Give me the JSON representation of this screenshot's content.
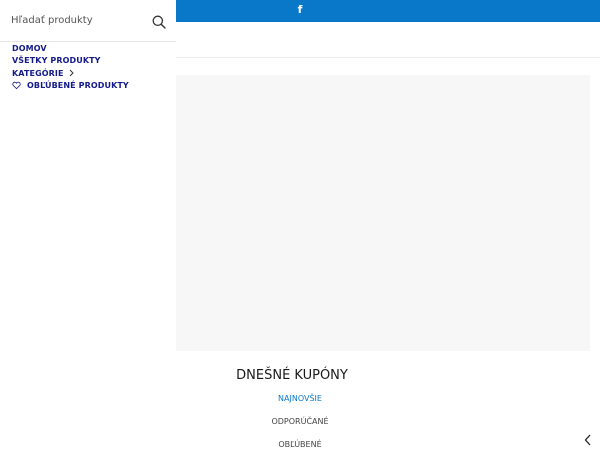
{
  "topbar": {
    "facebook_icon": "f",
    "color": "#0a78c8"
  },
  "search": {
    "placeholder": "Hľadať produkty",
    "icon": "search-icon"
  },
  "menu": {
    "items": [
      {
        "label": "DOMOV"
      },
      {
        "label": "VŠETKY PRODUKTY"
      },
      {
        "label": "KATEGÓRIE"
      },
      {
        "label": "OBĽÚBENÉ PRODUKTY"
      }
    ],
    "color": "#151b8a"
  },
  "section": {
    "title": "DNEŠNÉ KUPÓNY",
    "tabs": [
      {
        "label": "NAJNOVŠIE"
      },
      {
        "label": "ODPORÚČANÉ"
      },
      {
        "label": "OBĽÚBENÉ"
      }
    ],
    "active_color": "#0a78c8"
  }
}
